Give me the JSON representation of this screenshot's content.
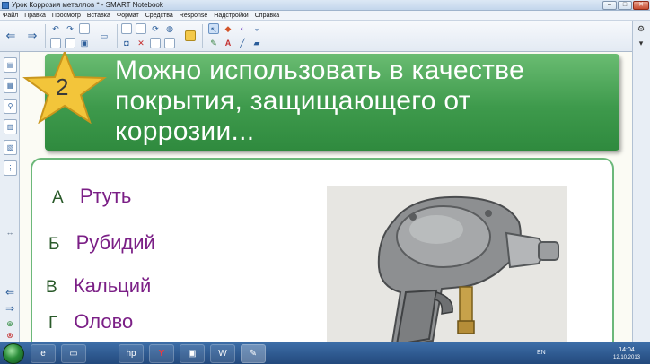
{
  "window": {
    "title": "Урок Коррозия металлов * - SMART Notebook",
    "controls": [
      "–",
      "□",
      "✕"
    ]
  },
  "menu": [
    "Файл",
    "Правка",
    "Просмотр",
    "Вставка",
    "Формат",
    "Средства",
    "Response",
    "Надстройки",
    "Справка"
  ],
  "slide": {
    "number": "2",
    "title": "Можно использовать в качестве покрытия, защищающего от коррозии...",
    "options": [
      {
        "letter": "А",
        "text": "Ртуть"
      },
      {
        "letter": "Б",
        "text": "Рубидий"
      },
      {
        "letter": "В",
        "text": "Кальций"
      },
      {
        "letter": "Г",
        "text": "Олово"
      }
    ],
    "colors": {
      "banner": "#3e9a4c",
      "star": "#f3c53a",
      "option_text": "#7b1f86",
      "option_letter": "#2a5a2a"
    }
  },
  "taskbar": {
    "apps": [
      "explorer-icon",
      "folder-icon",
      "hp-icon",
      "yandex-icon",
      "presentation-icon",
      "word-icon",
      "notebook-icon"
    ],
    "language": "EN",
    "time": "14:04",
    "date": "12.10.2013"
  }
}
